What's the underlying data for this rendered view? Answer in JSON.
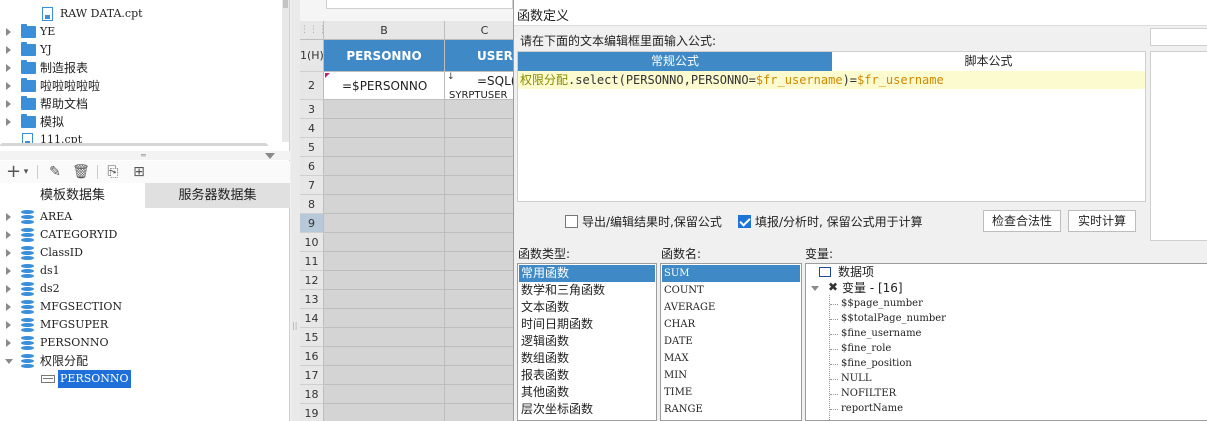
{
  "file_tree": {
    "items": [
      {
        "label": "RAW DATA.cpt",
        "type": "file"
      },
      {
        "label": "YE",
        "type": "folder"
      },
      {
        "label": "YJ",
        "type": "folder"
      },
      {
        "label": "制造报表",
        "type": "folder"
      },
      {
        "label": "啦啦啦啦啦",
        "type": "folder"
      },
      {
        "label": "帮助文档",
        "type": "folder"
      },
      {
        "label": "模拟",
        "type": "folder"
      },
      {
        "label": "111.cpt",
        "type": "file"
      }
    ]
  },
  "ds_toolbar": {
    "add_label": "+",
    "edit_icon": "pencil-icon",
    "delete_icon": "trash-icon",
    "preview_icon": "preview-icon",
    "settings_icon": "table-settings-icon"
  },
  "ds_tabs": {
    "template": "模板数据集",
    "server": "服务器数据集"
  },
  "datasets": {
    "items": [
      {
        "label": "AREA"
      },
      {
        "label": "CATEGORYID"
      },
      {
        "label": "ClassID"
      },
      {
        "label": "ds1"
      },
      {
        "label": "ds2"
      },
      {
        "label": "MFGSECTION"
      },
      {
        "label": "MFGSUPER"
      },
      {
        "label": "PERSONNO"
      },
      {
        "label": "权限分配"
      }
    ],
    "child": {
      "label": "PERSONNO"
    }
  },
  "sheet": {
    "corner": "⋮⋮⋮",
    "col_b": "B",
    "col_c": "C",
    "row_1": "1(H)",
    "header_b": "PERSONNO",
    "header_c": "USERN",
    "cell_b2": "=$PERSONNO",
    "cell_c2_line1": "=SQL(",
    "cell_c2_line2": "SYRPTUSER",
    "rows": [
      "2",
      "3",
      "4",
      "5",
      "6",
      "7",
      "8",
      "9",
      "10",
      "11",
      "12",
      "13",
      "14",
      "15",
      "16",
      "17",
      "18",
      "19"
    ]
  },
  "dialog": {
    "title": "函数定义",
    "prompt": "请在下面的文本编辑框里面输入公式:",
    "tab_normal": "常规公式",
    "tab_script": "脚本公式",
    "formula": {
      "func": "权限分配",
      "mid": ".select(PERSONNO,PERSONNO=",
      "var1": "$fr_username",
      "close": ")=",
      "var2": "$fr_username"
    },
    "opt_export": "导出/编辑结果时,保留公式",
    "opt_fill": "填报/分析时, 保留公式用于计算",
    "opt_export_checked": false,
    "opt_fill_checked": true,
    "btn_check": "检查合法性",
    "btn_realtime": "实时计算",
    "label_func_type": "函数类型:",
    "label_func_name": "函数名:",
    "label_variable": "变量:",
    "func_types": [
      "常用函数",
      "数学和三角函数",
      "文本函数",
      "时间日期函数",
      "逻辑函数",
      "数组函数",
      "报表函数",
      "其他函数",
      "层次坐标函数"
    ],
    "func_names": [
      "SUM",
      "COUNT",
      "AVERAGE",
      "CHAR",
      "DATE",
      "MAX",
      "MIN",
      "TIME",
      "RANGE"
    ],
    "variables": {
      "data_item": "数据项",
      "var_group": "变量 - [16]",
      "items": [
        "$$page_number",
        "$$totalPage_number",
        "$fine_username",
        "$fine_role",
        "$fine_position",
        "NULL",
        "NOFILTER",
        "reportName"
      ]
    }
  }
}
